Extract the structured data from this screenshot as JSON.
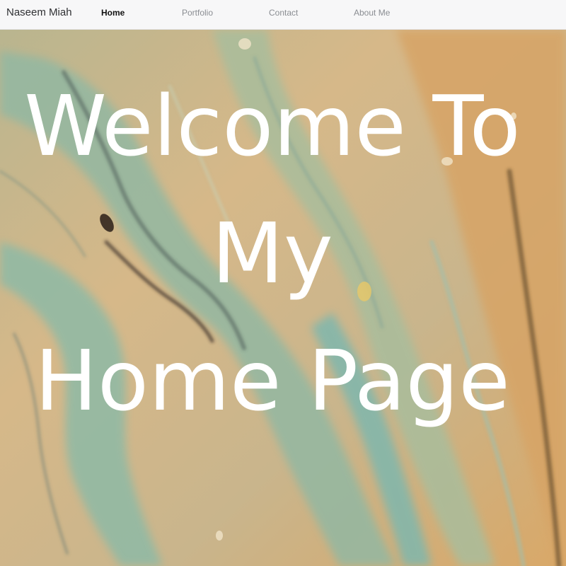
{
  "navbar": {
    "brand": "Naseem Miah",
    "links": [
      {
        "label": "Home",
        "active": true
      },
      {
        "label": "Portfolio",
        "active": false
      },
      {
        "label": "Contact",
        "active": false
      },
      {
        "label": "About Me",
        "active": false
      }
    ]
  },
  "hero": {
    "title_lines": [
      "Welcome To",
      "My",
      "Home Page"
    ],
    "background": "marbled acrylic paint texture",
    "colors": {
      "sand": "#d9b98a",
      "teal": "#8fb9a5",
      "sage": "#a9b79a",
      "orange": "#e3a35c",
      "dark_brown": "#4a3a2a",
      "text": "#ffffff"
    }
  }
}
